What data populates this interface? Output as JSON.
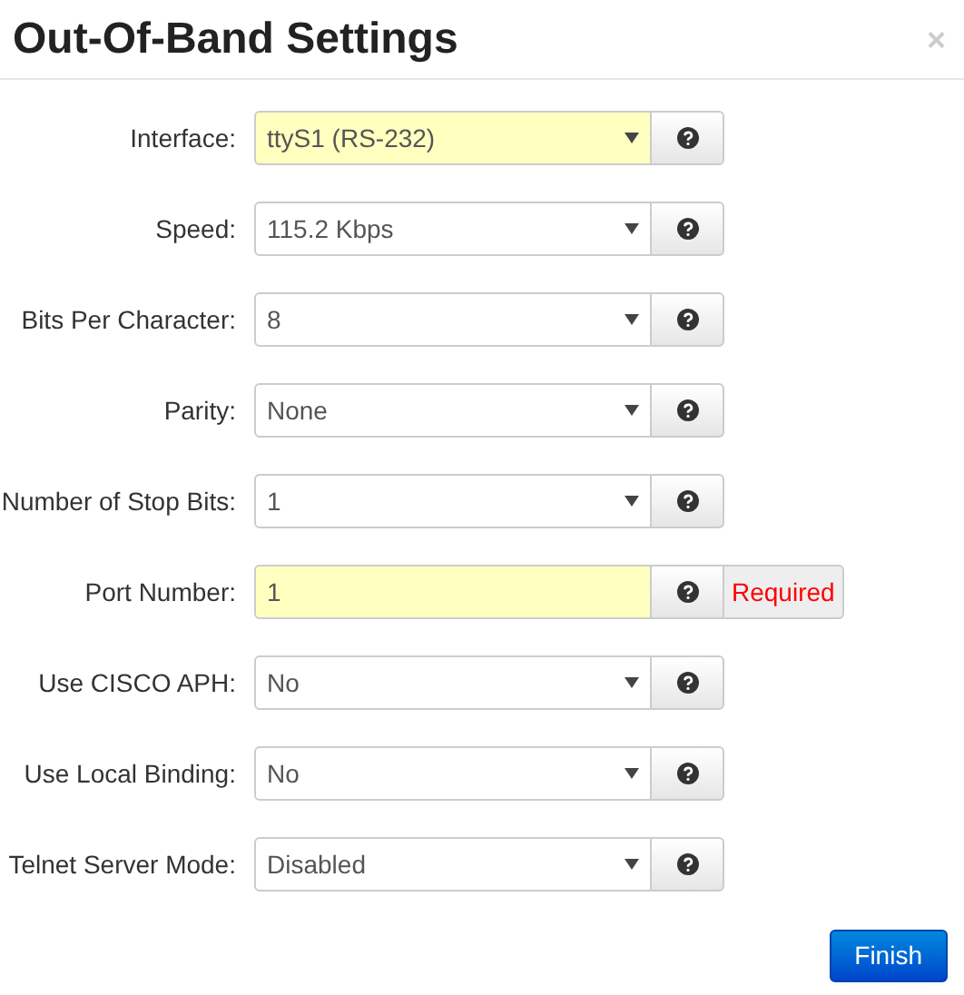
{
  "dialog": {
    "title": "Out-Of-Band Settings",
    "close": "×"
  },
  "fields": [
    {
      "label": "Interface:",
      "kind": "select",
      "value": "ttyS1 (RS-232)",
      "highlighted": true
    },
    {
      "label": "Speed:",
      "kind": "select",
      "value": "115.2 Kbps",
      "highlighted": false
    },
    {
      "label": "Bits Per Character:",
      "kind": "select",
      "value": "8",
      "highlighted": false
    },
    {
      "label": "Parity:",
      "kind": "select",
      "value": "None",
      "highlighted": false
    },
    {
      "label": "Number of Stop Bits:",
      "kind": "select",
      "value": "1",
      "highlighted": false
    },
    {
      "label": "Port Number:",
      "kind": "text",
      "value": "1",
      "highlighted": true,
      "error": "Required"
    },
    {
      "label": "Use CISCO APH:",
      "kind": "select",
      "value": "No",
      "highlighted": false
    },
    {
      "label": "Use Local Binding:",
      "kind": "select",
      "value": "No",
      "highlighted": false
    },
    {
      "label": "Telnet Server Mode:",
      "kind": "select",
      "value": "Disabled",
      "highlighted": false
    }
  ],
  "buttons": [
    {
      "label": "Finish"
    }
  ]
}
